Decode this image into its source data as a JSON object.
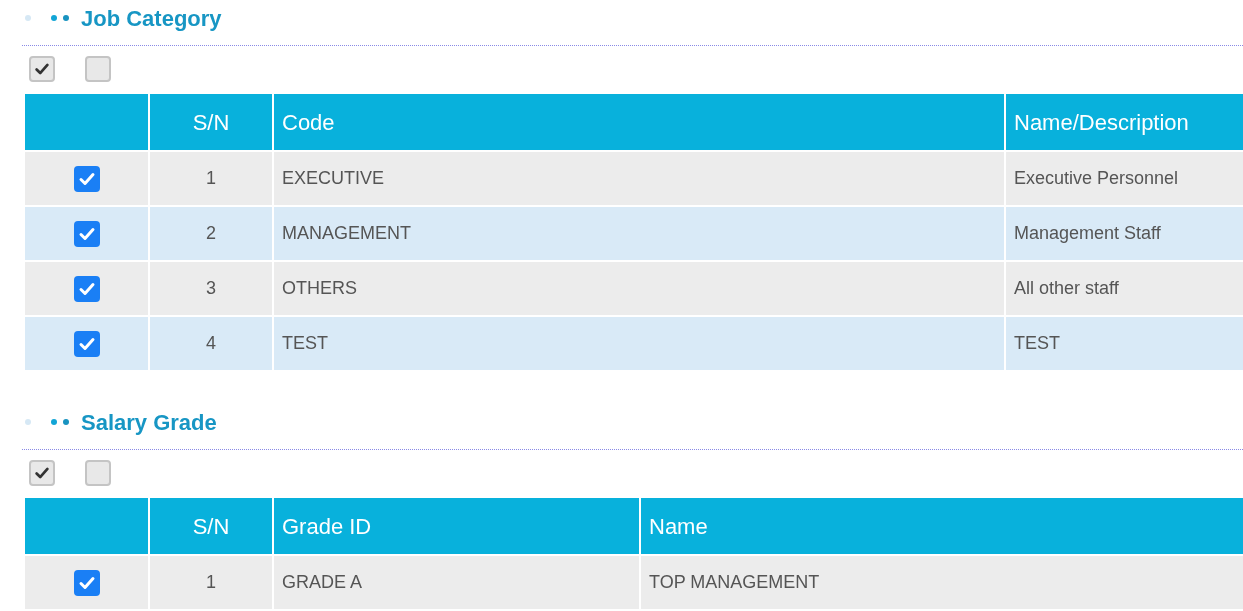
{
  "sections": [
    {
      "title": "Job Category",
      "toggles": [
        {
          "checked": true
        },
        {
          "checked": false
        }
      ],
      "table": {
        "columns": [
          "S/N",
          "Code",
          "Name/Description"
        ],
        "rows": [
          {
            "checked": true,
            "cells": [
              "1",
              "EXECUTIVE",
              "Executive Personnel"
            ]
          },
          {
            "checked": true,
            "cells": [
              "2",
              "MANAGEMENT",
              "Management Staff"
            ]
          },
          {
            "checked": true,
            "cells": [
              "3",
              "OTHERS",
              "All other staff"
            ]
          },
          {
            "checked": true,
            "cells": [
              "4",
              "TEST",
              "TEST"
            ]
          }
        ]
      }
    },
    {
      "title": "Salary Grade",
      "toggles": [
        {
          "checked": true
        },
        {
          "checked": false
        }
      ],
      "table": {
        "columns": [
          "S/N",
          "Grade ID",
          "Name"
        ],
        "rows": [
          {
            "checked": true,
            "cells": [
              "1",
              "GRADE A",
              "TOP MANAGEMENT"
            ]
          }
        ]
      }
    }
  ]
}
